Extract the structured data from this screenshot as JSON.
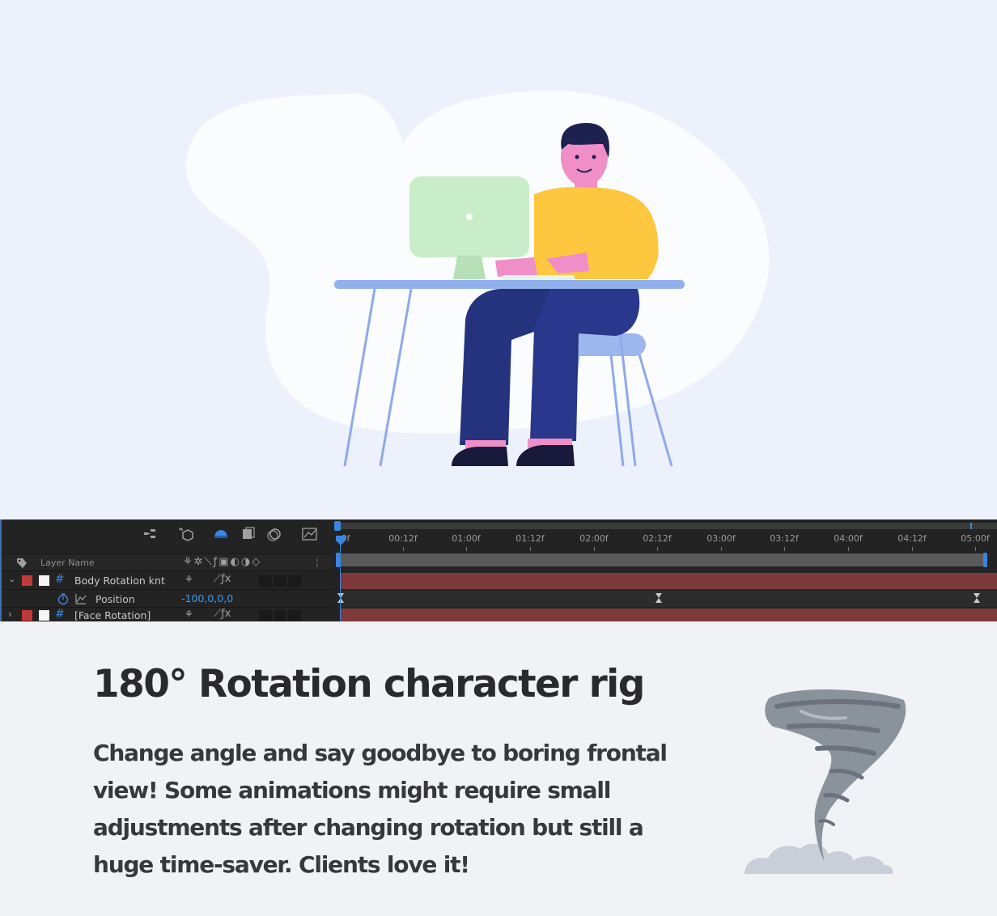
{
  "illustration": {
    "colors": {
      "background": "#edf1fb",
      "blob": "#fbfcfe",
      "monitor": "#c9ecc9",
      "shirt": "#fdc73f",
      "skin": "#f08ec7",
      "hair": "#1d2150",
      "pants": "#25337f",
      "desk": "#92b1ec",
      "chair": "#9bb7ee",
      "shoes": "#171a3a"
    }
  },
  "timeline": {
    "icons": [
      "composition-flowchart-icon",
      "draft-3d-icon",
      "shy-layers-icon",
      "frame-blending-icon",
      "motion-blur-icon",
      "graph-editor-icon"
    ],
    "column_header": {
      "label_icon": "tag-icon",
      "layer_name": "Layer Name"
    },
    "layers": [
      {
        "name": "Body Rotation knt",
        "label_color": "#c13a3a",
        "expanded": true,
        "type_icon": "null-hash-icon"
      },
      {
        "name": "[Face Rotation]",
        "label_color": "#c13a3a",
        "expanded": false,
        "type_icon": "null-hash-icon"
      }
    ],
    "property": {
      "name": "Position",
      "value": "-100,0,0,0"
    },
    "ruler": {
      "labels": [
        "0f",
        "00:12f",
        "01:00f",
        "01:12f",
        "02:00f",
        "02:12f",
        "03:00f",
        "03:12f",
        "04:00f",
        "04:12f",
        "05:00f"
      ]
    },
    "playhead_label": "0f",
    "colors": {
      "panel": "#232323",
      "layer_bar": "#7e3a3a",
      "accent": "#3a86e0",
      "value": "#3a9cf0"
    }
  },
  "content": {
    "headline": "180° Rotation character rig",
    "body": "Change angle and say goodbye to boring frontal view! Some animations might require small adjustments after changing rotation but still a huge time-saver. Clients love it!",
    "colors": {
      "headline": "#2a2a2e",
      "body": "#38383c",
      "tornado": "#8a929c",
      "cloud": "#c9cfd9"
    }
  }
}
